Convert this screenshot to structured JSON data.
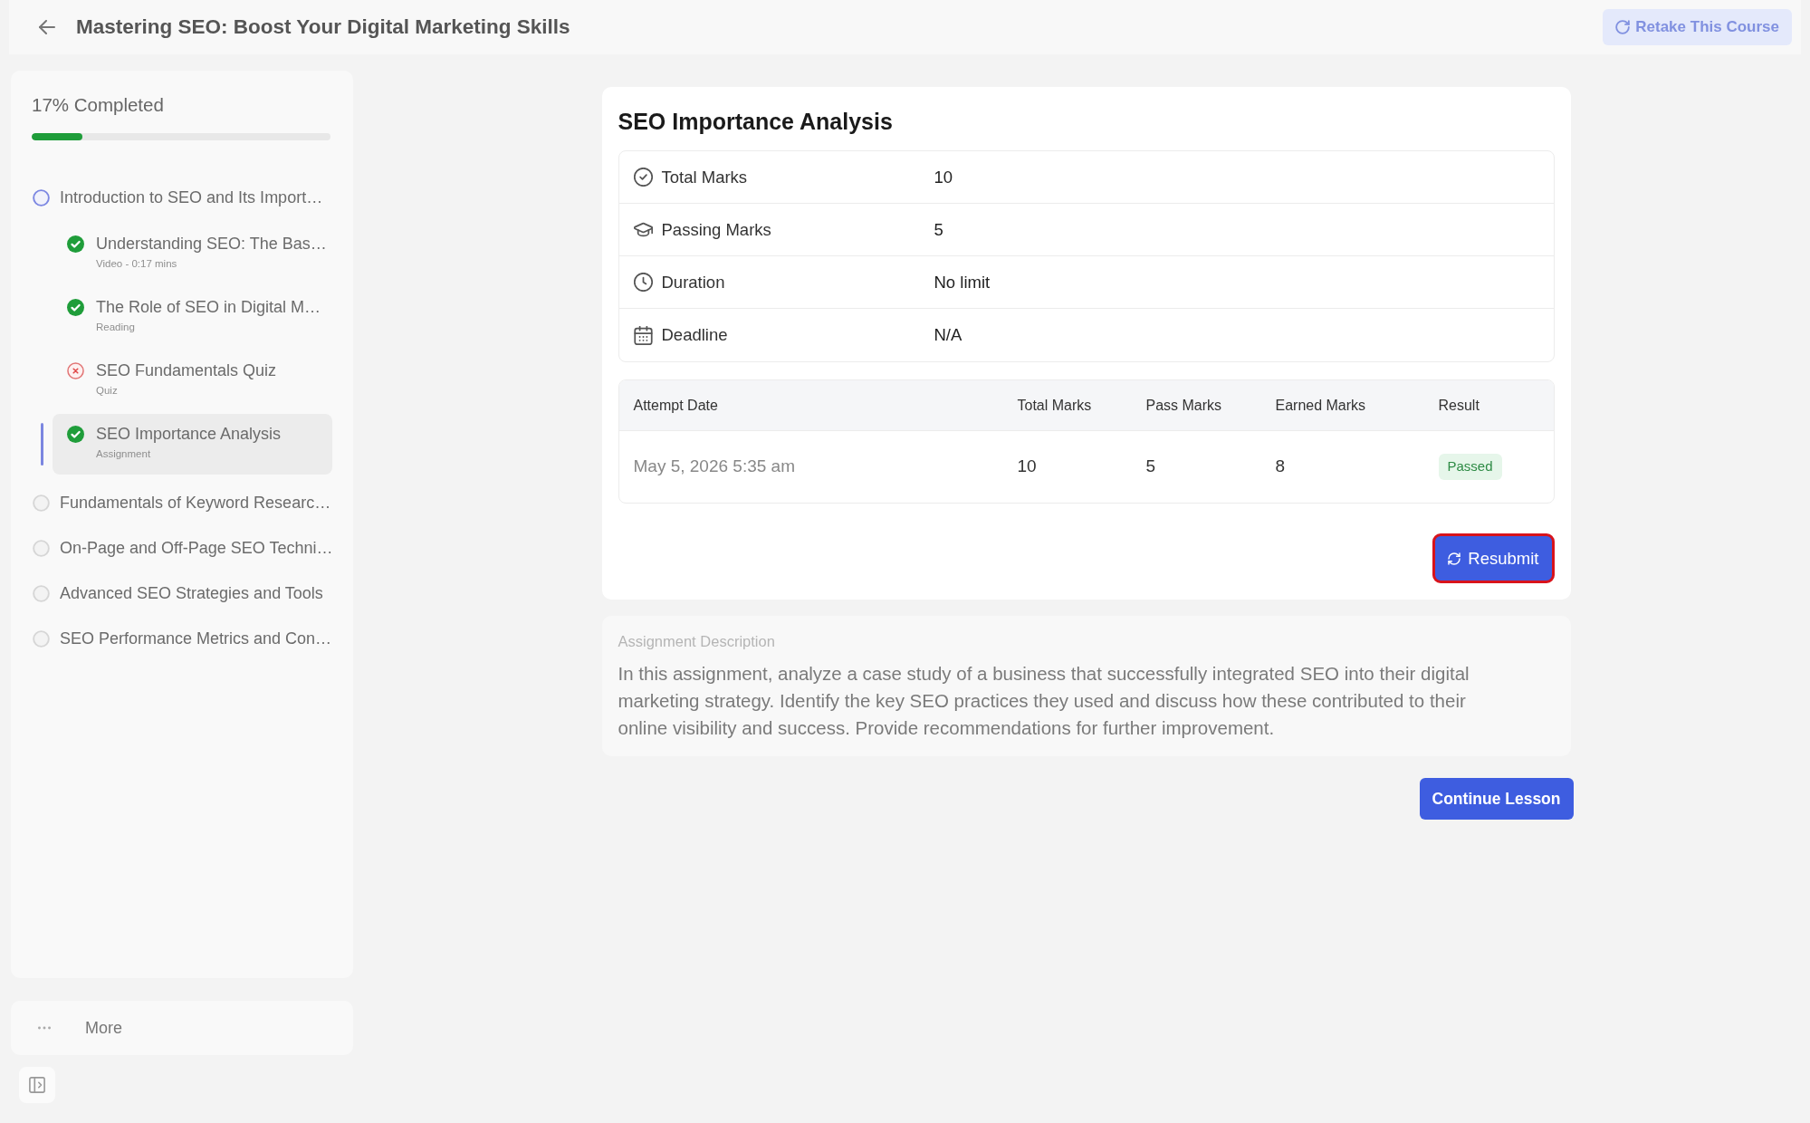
{
  "header": {
    "title": "Mastering SEO: Boost Your Digital Marketing Skills",
    "retake_button": "Retake This Course"
  },
  "sidebar": {
    "progress_label": "17% Completed",
    "progress": {
      "level": 0.17
    },
    "topics": [
      {
        "title": "Introduction to SEO and Its Import…",
        "kind": "current",
        "selected": false,
        "children": [
          {
            "title": "Understanding SEO: The Bas…",
            "meta": "Video - 0:17 mins",
            "kind": "done",
            "selected": false
          },
          {
            "title": "The Role of SEO in Digital M…",
            "meta": "Reading",
            "kind": "done",
            "selected": false
          },
          {
            "title": "SEO Fundamentals Quiz",
            "meta": "Quiz",
            "kind": "failed",
            "selected": false
          },
          {
            "title": "SEO Importance Analysis",
            "meta": "Assignment",
            "kind": "done",
            "selected": true
          }
        ]
      },
      {
        "title": "Fundamentals of Keyword Researc…",
        "kind": "pending",
        "selected": false
      },
      {
        "title": "On-Page and Off-Page SEO Techni…",
        "kind": "pending",
        "selected": false
      },
      {
        "title": "Advanced SEO Strategies and Tools",
        "kind": "pending",
        "selected": false
      },
      {
        "title": "SEO Performance Metrics and Con…",
        "kind": "pending",
        "selected": false
      }
    ],
    "more": "More"
  },
  "assignment": {
    "title": "SEO Importance Analysis",
    "details": [
      {
        "kind": "score",
        "label": "Total Marks",
        "value": "10"
      },
      {
        "kind": "pass",
        "label": "Passing Marks",
        "value": "5"
      },
      {
        "kind": "time",
        "label": "Duration",
        "value": "No limit"
      },
      {
        "kind": "date",
        "label": "Deadline",
        "value": "N/A"
      }
    ],
    "attempts": {
      "columns": [
        "Attempt Date",
        "Total Marks",
        "Pass Marks",
        "Earned Marks",
        "Result"
      ],
      "rows": [
        {
          "cells": [
            "May 5, 2026 5:35 am",
            "10",
            "5",
            "8"
          ],
          "result": {
            "label": "Passed",
            "kind": "passed"
          }
        }
      ]
    },
    "resubmit_button": {
      "label": "Resubmit",
      "highlighted": true
    }
  },
  "description": {
    "heading": "Assignment Description",
    "text": "In this assignment, analyze a case study of a business that successfully integrated SEO into their digital marketing strategy. Identify the key SEO practices they used and discuss how these contributed to their online visibility and success. Provide recommendations for further improvement."
  },
  "continue_button": "Continue Lesson"
}
